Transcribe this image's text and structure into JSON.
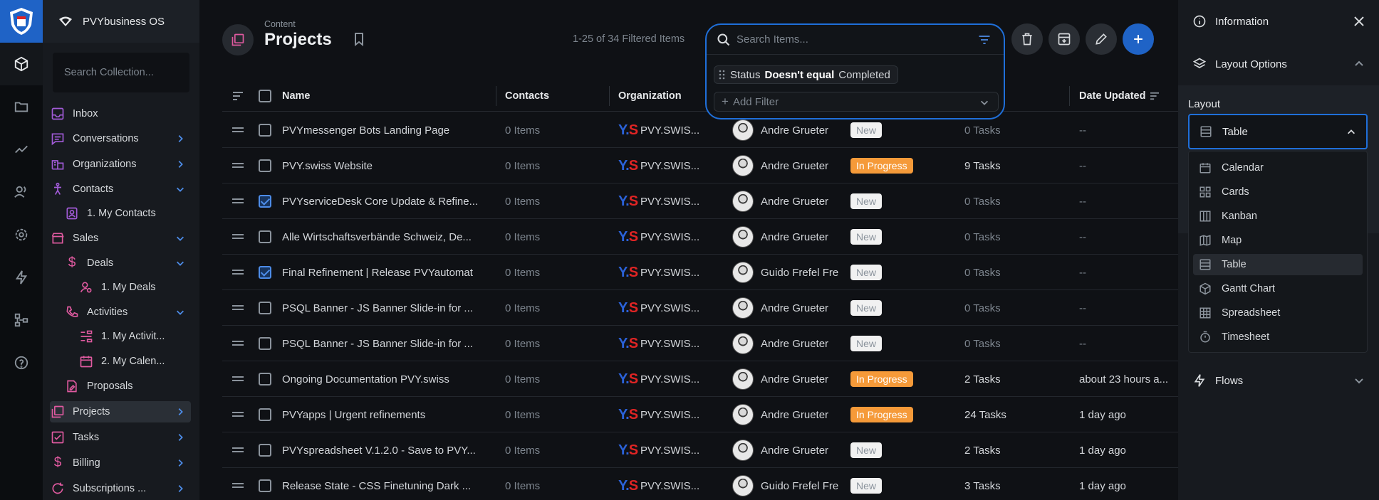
{
  "app": {
    "project_name": "PVYbusiness OS"
  },
  "nav": {
    "search_placeholder": "Search Collection...",
    "items": [
      {
        "label": "Inbox"
      },
      {
        "label": "Conversations"
      },
      {
        "label": "Organizations"
      },
      {
        "label": "Contacts"
      },
      {
        "label": "1. My Contacts"
      },
      {
        "label": "Sales"
      },
      {
        "label": "Deals"
      },
      {
        "label": "1. My Deals"
      },
      {
        "label": "Activities"
      },
      {
        "label": "1. My Activit..."
      },
      {
        "label": "2. My Calen..."
      },
      {
        "label": "Proposals"
      },
      {
        "label": "Projects"
      },
      {
        "label": "Tasks"
      },
      {
        "label": "Billing"
      },
      {
        "label": "Subscriptions ..."
      }
    ]
  },
  "header": {
    "breadcrumb": "Content",
    "title": "Projects",
    "count": "1-25 of 34 Filtered Items",
    "search_placeholder": "Search Items...",
    "filter": {
      "field": "Status",
      "operator": "Doesn't equal",
      "value": "Completed"
    },
    "add_filter": "Add Filter"
  },
  "table": {
    "columns": {
      "name": "Name",
      "contacts": "Contacts",
      "organization": "Organization",
      "date_updated": "Date Updated"
    },
    "rows": [
      {
        "name": "PVYmessenger Bots Landing Page",
        "contacts": "0 Items",
        "org": "PVY.SWIS...",
        "owner": "Andre Grueter",
        "status": "New",
        "tasks": "0 Tasks",
        "date": "--",
        "checked": false
      },
      {
        "name": "PVY.swiss Website",
        "contacts": "0 Items",
        "org": "PVY.SWIS...",
        "owner": "Andre Grueter",
        "status": "In Progress",
        "tasks": "9 Tasks",
        "date": "--",
        "checked": false
      },
      {
        "name": "PVYserviceDesk Core Update & Refine...",
        "contacts": "0 Items",
        "org": "PVY.SWIS...",
        "owner": "Andre Grueter",
        "status": "New",
        "tasks": "0 Tasks",
        "date": "--",
        "checked": true
      },
      {
        "name": "Alle Wirtschaftsverbände Schweiz, De...",
        "contacts": "0 Items",
        "org": "PVY.SWIS...",
        "owner": "Andre Grueter",
        "status": "New",
        "tasks": "0 Tasks",
        "date": "--",
        "checked": false
      },
      {
        "name": "Final Refinement | Release PVYautomat",
        "contacts": "0 Items",
        "org": "PVY.SWIS...",
        "owner": "Guido Frefel Fre",
        "status": "New",
        "tasks": "0 Tasks",
        "date": "--",
        "checked": true
      },
      {
        "name": "PSQL Banner - JS Banner Slide-in for ...",
        "contacts": "0 Items",
        "org": "PVY.SWIS...",
        "owner": "Andre Grueter",
        "status": "New",
        "tasks": "0 Tasks",
        "date": "--",
        "checked": false
      },
      {
        "name": "PSQL Banner - JS Banner Slide-in for ...",
        "contacts": "0 Items",
        "org": "PVY.SWIS...",
        "owner": "Andre Grueter",
        "status": "New",
        "tasks": "0 Tasks",
        "date": "--",
        "checked": false
      },
      {
        "name": "Ongoing Documentation PVY.swiss",
        "contacts": "0 Items",
        "org": "PVY.SWIS...",
        "owner": "Andre Grueter",
        "status": "In Progress",
        "tasks": "2 Tasks",
        "date": "about 23 hours a...",
        "checked": false
      },
      {
        "name": "PVYapps | Urgent refinements",
        "contacts": "0 Items",
        "org": "PVY.SWIS...",
        "owner": "Andre Grueter",
        "status": "In Progress",
        "tasks": "24 Tasks",
        "date": "1 day ago",
        "checked": false
      },
      {
        "name": "PVYspreadsheet V.1.2.0 - Save to PVY...",
        "contacts": "0 Items",
        "org": "PVY.SWIS...",
        "owner": "Andre Grueter",
        "status": "New",
        "tasks": "2 Tasks",
        "date": "1 day ago",
        "checked": false
      },
      {
        "name": "Release State - CSS Finetuning Dark ...",
        "contacts": "0 Items",
        "org": "PVY.SWIS...",
        "owner": "Guido Frefel Fre",
        "status": "New",
        "tasks": "3 Tasks",
        "date": "1 day ago",
        "checked": false
      }
    ]
  },
  "sidebar": {
    "information": "Information",
    "layout_options": "Layout Options",
    "layout_label": "Layout",
    "layout_value": "Table",
    "layouts": [
      "Calendar",
      "Cards",
      "Kanban",
      "Map",
      "Table",
      "Gantt Chart",
      "Spreadsheet",
      "Timesheet"
    ],
    "flows": "Flows"
  },
  "colors": {
    "accent": "#1f63c6",
    "in_progress": "#f59a39",
    "new": "#f1f1f1",
    "nav_icon": "#a25bd8"
  }
}
